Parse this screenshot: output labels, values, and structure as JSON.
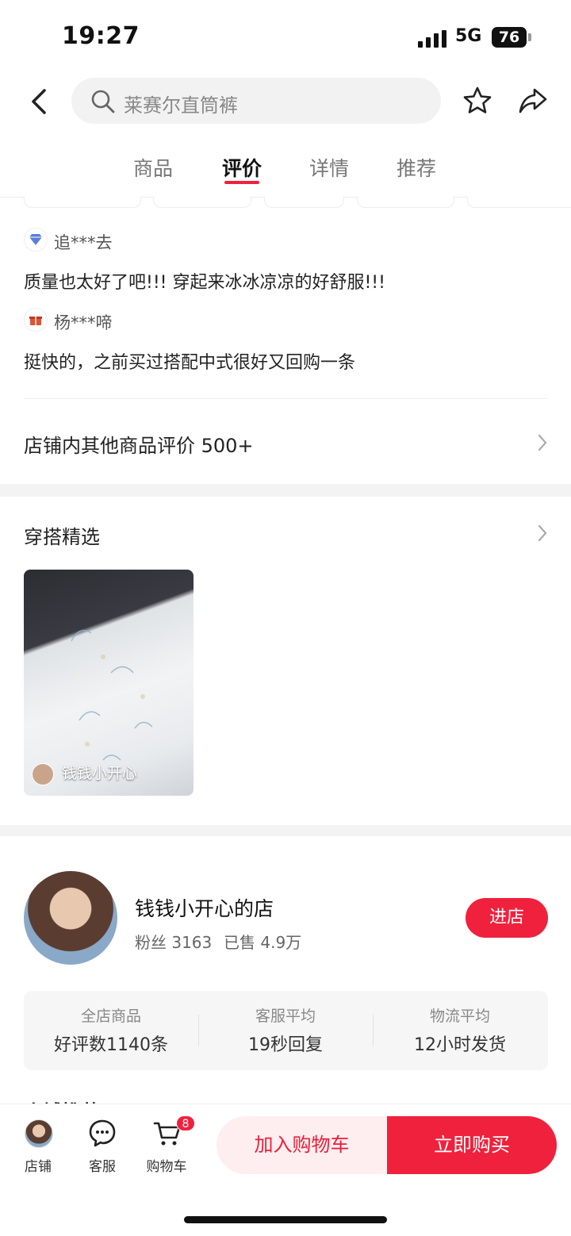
{
  "status_bar": {
    "time": "19:27",
    "network": "5G",
    "battery": "76"
  },
  "header": {
    "search_placeholder": "莱赛尔直筒裤"
  },
  "tabs": [
    {
      "label": "商品",
      "active": false
    },
    {
      "label": "评价",
      "active": true
    },
    {
      "label": "详情",
      "active": false
    },
    {
      "label": "推荐",
      "active": false
    }
  ],
  "reviews": [
    {
      "user": "追***去",
      "badge_icon": "diamond-icon",
      "text": "质量也太好了吧!!!  穿起来冰冰凉凉的好舒服!!!"
    },
    {
      "user": "杨***啼",
      "badge_icon": "gift-icon",
      "text": "挺快的，之前买过搭配中式很好又回购一条"
    }
  ],
  "other_reviews": {
    "label": "店铺内其他商品评价 500+"
  },
  "outfit": {
    "section_title": "穿搭精选",
    "card_caption": "钱钱小开心"
  },
  "shop": {
    "name": "钱钱小开心的店",
    "followers": "粉丝 3163",
    "sold": "已售 4.9万",
    "enter_label": "进店",
    "stats": [
      {
        "label": "全店商品",
        "value": "好评数1140条"
      },
      {
        "label": "客服平均",
        "value": "19秒回复"
      },
      {
        "label": "物流平均",
        "value": "12小时发货"
      }
    ],
    "partial_next": "店铺推荐"
  },
  "bottom_bar": {
    "shop_label": "店铺",
    "service_label": "客服",
    "cart_label": "购物车",
    "cart_count": "8",
    "add_to_cart": "加入购物车",
    "buy_now": "立即购买"
  },
  "colors": {
    "accent": "#f0213c",
    "accent_light": "#ffeef0"
  }
}
